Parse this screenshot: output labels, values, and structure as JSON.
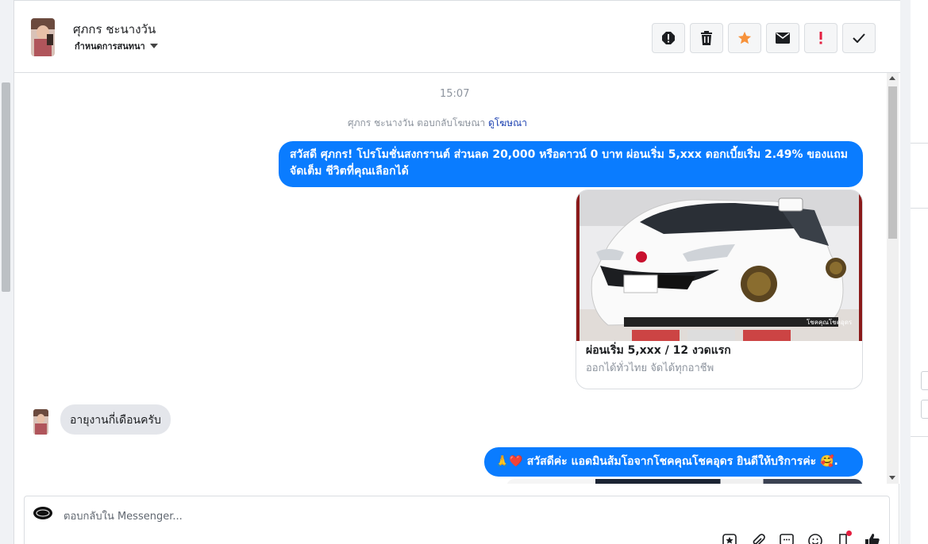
{
  "header": {
    "contact_name": "ศุภกร ชะนางวัน",
    "subtitle": "กำหนดการสนทนา",
    "actions": [
      {
        "name": "alert-icon",
        "label": "!",
        "color": "#1c1e21"
      },
      {
        "name": "trash-icon",
        "label": "",
        "color": "#1c1e21"
      },
      {
        "name": "star-icon",
        "label": "",
        "color": "#f7923b"
      },
      {
        "name": "envelope-icon",
        "label": "",
        "color": "#1c1e21"
      },
      {
        "name": "exclamation-icon",
        "label": "!",
        "color": "#e41e3f"
      },
      {
        "name": "check-icon",
        "label": "",
        "color": "#1c1e21"
      }
    ]
  },
  "conversation": {
    "timestamp": "15:07",
    "ad_reply_prefix": "ศุภกร ชะนางวัน ตอบกลับโฆษณา",
    "ad_link": "ดูโฆษณา",
    "messages": [
      {
        "direction": "out",
        "text": "สวัสดี ศุภกร! โปรโมชั่นสงกรานต์ ส่วนลด 20,000 หรือดาวน์ 0 บาท ผ่อนเริ่ม 5,xxx ดอกเบี้ยเริ่ม 2.49% ของแถมจัดเต็ม ชีวิตที่คุณเลือกได้"
      },
      {
        "direction": "in",
        "text": "อายุงานกี่เดือนครับ"
      },
      {
        "direction": "out",
        "text": "🙏❤️ สวัสดีค่ะ แอดมินส้มโอจากโชคคุณโชคอุดร ยินดีให้บริการค่ะ 🥰."
      }
    ],
    "ad_card": {
      "title": "ผ่อนเริ่ม 5,xxx / 12 งวดแรก",
      "subtitle": "ออกได้ทั่วไทย จัดได้ทุกอาชีพ",
      "image_caption": "โชคคุณโชคอุดร"
    }
  },
  "composer": {
    "placeholder": "ตอบกลับใน Messenger...",
    "tools": [
      "star-box-icon",
      "paperclip-icon",
      "saved-reply-icon",
      "emoji-icon",
      "bookmark-icon",
      "thumbs-up-icon"
    ]
  },
  "colors": {
    "accent": "#0a7cff",
    "link": "#1a3fb0",
    "incoming_bubble": "#e4e6eb"
  }
}
